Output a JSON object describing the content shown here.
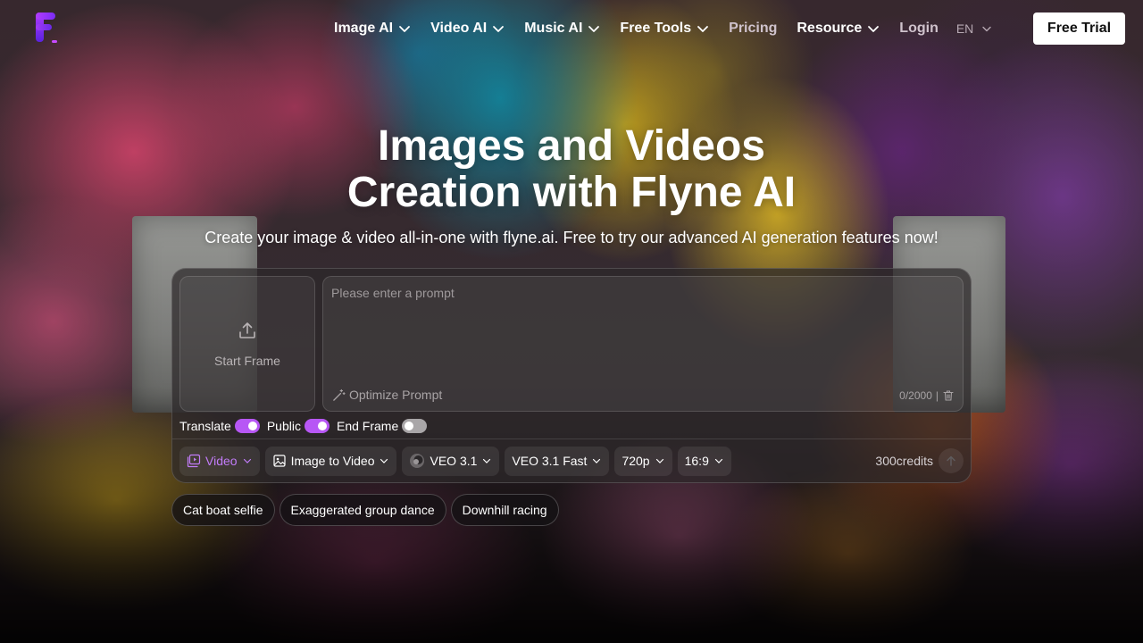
{
  "nav": {
    "items": [
      {
        "label": "Image AI",
        "dropdown": true
      },
      {
        "label": "Video AI",
        "dropdown": true
      },
      {
        "label": "Music AI",
        "dropdown": true
      },
      {
        "label": "Free Tools",
        "dropdown": true
      },
      {
        "label": "Pricing",
        "dropdown": false
      },
      {
        "label": "Resource",
        "dropdown": true
      }
    ],
    "login": "Login",
    "language": "EN",
    "cta": "Free Trial"
  },
  "hero": {
    "title_line1": "Images and Videos",
    "title_line2": "Creation with Flyne AI",
    "subtitle": "Create your image & video all-in-one with flyne.ai. Free to try our advanced AI generation features now!"
  },
  "generator": {
    "start_frame_label": "Start Frame",
    "prompt_placeholder": "Please enter a prompt",
    "prompt_value": "",
    "optimize_label": "Optimize Prompt",
    "char_count": "0/2000",
    "toggles": [
      {
        "label": "Translate",
        "on": true
      },
      {
        "label": "Public",
        "on": true
      },
      {
        "label": "End Frame",
        "on": false
      }
    ],
    "mode": "Video",
    "task": "Image to Video",
    "model": "VEO 3.1",
    "model_variant": "VEO 3.1 Fast",
    "resolution": "720p",
    "aspect_ratio": "16:9",
    "credits": "300credits"
  },
  "suggestions": [
    "Cat boat selfie",
    "Exaggerated group dance",
    "Downhill racing"
  ],
  "colors": {
    "accent": "#b757f5",
    "cta_bg": "#ffffff",
    "panel_bg": "#2c282a"
  },
  "icons": [
    "logo-icon",
    "chevron-down-icon",
    "upload-icon",
    "magic-wand-icon",
    "trash-icon",
    "video-icon",
    "image-icon",
    "model-icon",
    "arrow-up-icon"
  ]
}
